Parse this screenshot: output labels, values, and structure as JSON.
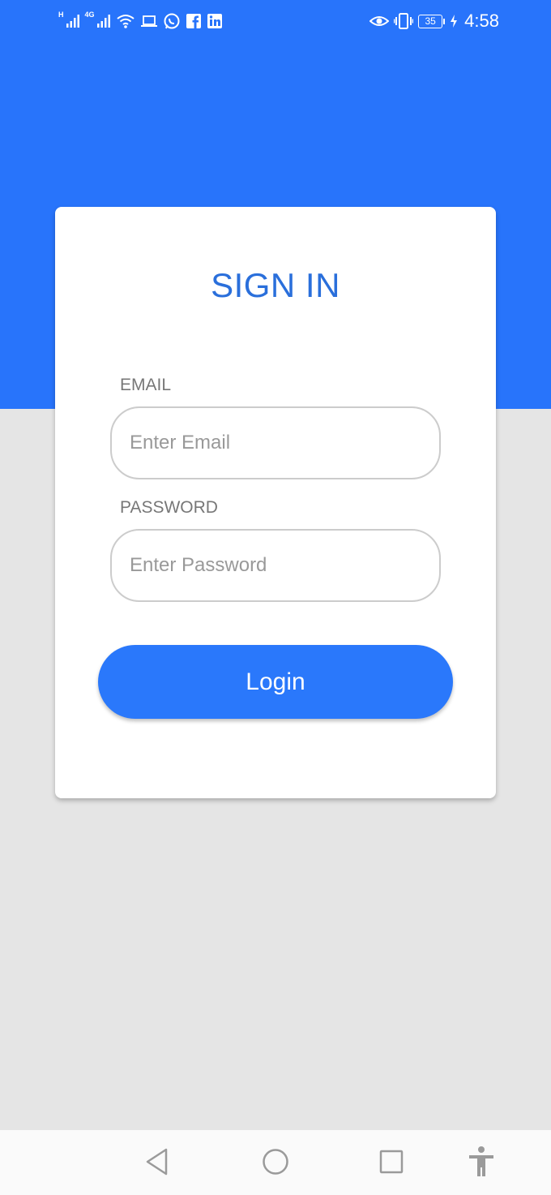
{
  "status_bar": {
    "signal1_label": "H",
    "signal2_label": "4G",
    "battery_level": "35",
    "time": "4:58",
    "left_icons": [
      "signal-h-icon",
      "signal-4g-icon",
      "wifi-icon",
      "laptop-icon",
      "whatsapp-icon",
      "facebook-icon",
      "linkedin-icon"
    ],
    "right_icons": [
      "eye-icon",
      "vibrate-icon",
      "battery-icon",
      "charging-icon"
    ]
  },
  "login_form": {
    "title": "SIGN IN",
    "email": {
      "label": "EMAIL",
      "placeholder": "Enter Email",
      "value": ""
    },
    "password": {
      "label": "PASSWORD",
      "placeholder": "Enter Password",
      "value": ""
    },
    "submit_label": "Login"
  },
  "nav_bar": {
    "buttons": [
      "back-icon",
      "home-icon",
      "recents-icon",
      "accessibility-icon"
    ]
  },
  "colors": {
    "header_blue": "#2874fb",
    "title_blue": "#2a6fdb",
    "button_blue": "#2a78fb",
    "background_gray": "#e5e5e5",
    "card_white": "#ffffff"
  }
}
